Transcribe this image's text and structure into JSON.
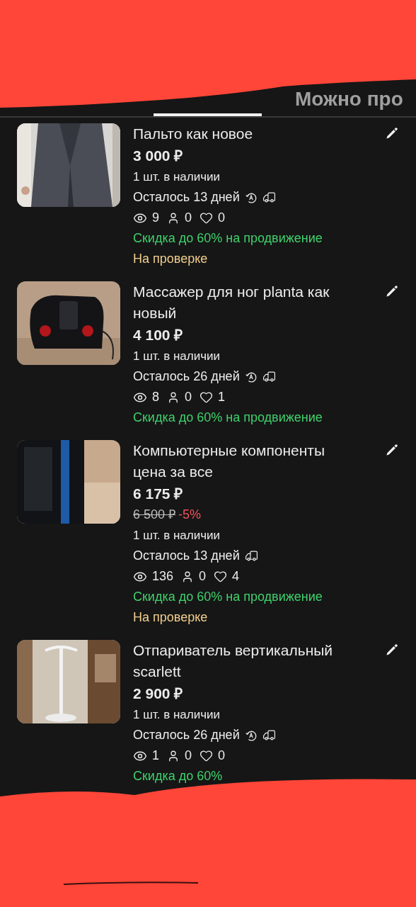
{
  "tabs": [
    {
      "selected": true
    },
    {
      "label": "Можно про",
      "selected": false
    }
  ],
  "listings": [
    {
      "title": "Пальто как новое",
      "price": "3 000 ₽",
      "stock": "1 шт. в наличии",
      "remaining": "Осталось 13 дней",
      "autorenew": true,
      "delivery": true,
      "views": "9",
      "contacts": "0",
      "favorites": "0",
      "promo": "Скидка до 60% на продвижение",
      "status": "На проверке"
    },
    {
      "title": "Массажер для ног planta как новый",
      "price": "4 100 ₽",
      "stock": "1 шт. в наличии",
      "remaining": "Осталось 26 дней",
      "autorenew": true,
      "delivery": true,
      "views": "8",
      "contacts": "0",
      "favorites": "1",
      "promo": "Скидка до 60% на продвижение"
    },
    {
      "title": "Компьютерные компоненты цена за все",
      "price": "6 175 ₽",
      "old_price": "6 500 ₽",
      "discount": "-5%",
      "stock": "1 шт. в наличии",
      "remaining": "Осталось 13 дней",
      "autorenew": false,
      "delivery": true,
      "views": "136",
      "contacts": "0",
      "favorites": "4",
      "promo": "Скидка до 60% на продвижение",
      "status": "На проверке"
    },
    {
      "title": "Отпариватель вертикальный scarlett",
      "price": "2 900 ₽",
      "stock": "1 шт. в наличии",
      "remaining": "Осталось 26 дней",
      "autorenew": true,
      "delivery": true,
      "views": "1",
      "contacts": "0",
      "favorites": "0",
      "promo": "Скидка до 60%"
    }
  ]
}
